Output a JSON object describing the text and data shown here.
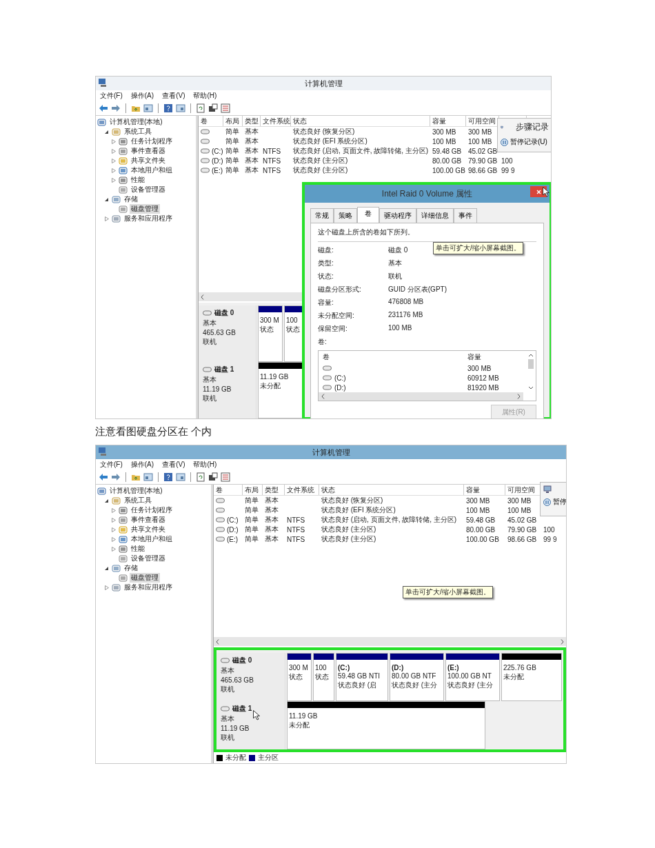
{
  "screenshots": [
    {
      "title": "计算机管理",
      "disks_highlighted": false,
      "menu": [
        "文件(F)",
        "操作(A)",
        "查看(V)",
        "帮助(H)"
      ],
      "tree": [
        {
          "label": "计算机管理(本地)",
          "selected": false,
          "children": [
            {
              "label": "系统工具",
              "selected": false,
              "expanded": true,
              "children": [
                {
                  "label": "任务计划程序",
                  "selected": false,
                  "expanded": false
                },
                {
                  "label": "事件查看器",
                  "selected": false,
                  "expanded": false
                },
                {
                  "label": "共享文件夹",
                  "selected": false,
                  "expanded": false
                },
                {
                  "label": "本地用户和组",
                  "selected": false,
                  "expanded": false
                },
                {
                  "label": "性能",
                  "selected": false,
                  "expanded": false
                },
                {
                  "label": "设备管理器",
                  "selected": false
                }
              ]
            },
            {
              "label": "存储",
              "selected": false,
              "expanded": true,
              "children": [
                {
                  "label": "磁盘管理",
                  "selected": true
                }
              ]
            },
            {
              "label": "服务和应用程序",
              "selected": false,
              "expanded": false
            }
          ]
        }
      ],
      "volume_table": {
        "columns": [
          "卷",
          "布局",
          "类型",
          "文件系统",
          "状态",
          "容量",
          "可用空间"
        ],
        "rows": [
          {
            "layout": "简单",
            "type": "基本",
            "status": "状态良好 (恢复分区)",
            "capacity": "300 MB",
            "free": "300 MB"
          },
          {
            "layout": "简单",
            "type": "基本",
            "status": "状态良好 (EFI 系统分区)",
            "capacity": "100 MB",
            "free": "100 MB"
          },
          {
            "volume": "(C:)",
            "layout": "简单",
            "type": "基本",
            "file_system": "NTFS",
            "status": "状态良好 (启动, 页面文件, 故障转储, 主分区)",
            "capacity": "59.48 GB",
            "free": "45.02 GB"
          },
          {
            "volume": "(D:)",
            "layout": "简单",
            "type": "基本",
            "file_system": "NTFS",
            "status": "状态良好 (主分区)",
            "capacity": "80.00 GB",
            "free": "79.90 GB",
            "column_8": "100"
          },
          {
            "volume": "(E:)",
            "layout": "简单",
            "type": "基本",
            "file_system": "NTFS",
            "status": "状态良好 (主分区)",
            "capacity": "100.00 GB",
            "free": "98.66 GB",
            "column_8": "99 9"
          }
        ]
      },
      "steps_recorder": {
        "title": "步骤记录",
        "button": "暂停记录(U)"
      },
      "disks": [
        {
          "name": "磁盘 0",
          "type": "基本",
          "size": "465.63 GB",
          "status": "联机",
          "partitions": [
            {
              "kind": "primary",
              "summary": "300 M",
              "status": "状态"
            },
            {
              "kind": "primary",
              "summary": "100",
              "status": "状态"
            }
          ]
        },
        {
          "name": "磁盘 1",
          "type": "基本",
          "size": "11.19 GB",
          "status": "联机",
          "partitions": [
            {
              "kind": "unallocated",
              "summary": "11.19 GB",
              "status": "未分配"
            }
          ]
        }
      ],
      "tooltip": "单击可扩大/缩小屏幕截图。",
      "dialog": {
        "title": "Intel Raid 0 Volume 属性",
        "highlighted": true,
        "tabs": [
          {
            "label": "常规",
            "selected": false
          },
          {
            "label": "策略",
            "selected": false
          },
          {
            "label": "卷",
            "selected": true
          },
          {
            "label": "驱动程序",
            "selected": false
          },
          {
            "label": "详细信息",
            "selected": false
          },
          {
            "label": "事件",
            "selected": false
          }
        ],
        "intro": "这个磁盘上所含的卷如下所列。",
        "properties": [
          {
            "label": "磁盘:",
            "value": "磁盘 0"
          },
          {
            "label": "类型:",
            "value": "基本"
          },
          {
            "label": "状态:",
            "value": "联机"
          },
          {
            "label": "磁盘分区形式:",
            "value": "GUID 分区表(GPT)"
          },
          {
            "label": "容量:",
            "value": "476808 MB"
          },
          {
            "label": "未分配空间:",
            "value": "231176 MB"
          },
          {
            "label": "保留空间:",
            "value": "100 MB"
          }
        ],
        "volumes_label": "卷:",
        "volumes": {
          "columns": [
            "卷",
            "容量"
          ],
          "rows": [
            {
              "capacity": "300 MB"
            },
            {
              "volume": "(C:)",
              "capacity": "60912 MB"
            },
            {
              "volume": "(D:)",
              "capacity": "81920 MB"
            }
          ]
        },
        "button": {
          "label": "属性(R)",
          "disabled": true
        }
      }
    },
    {
      "title": "计算机管理",
      "disks_highlighted": true,
      "menu": [
        "文件(F)",
        "操作(A)",
        "查看(V)",
        "帮助(H)"
      ],
      "tree": [
        {
          "label": "计算机管理(本地)",
          "selected": false,
          "children": [
            {
              "label": "系统工具",
              "selected": false,
              "expanded": true,
              "children": [
                {
                  "label": "任务计划程序",
                  "selected": false,
                  "expanded": false
                },
                {
                  "label": "事件查看器",
                  "selected": false,
                  "expanded": false
                },
                {
                  "label": "共享文件夹",
                  "selected": false,
                  "expanded": false
                },
                {
                  "label": "本地用户和组",
                  "selected": false,
                  "expanded": false
                },
                {
                  "label": "性能",
                  "selected": false,
                  "expanded": false
                },
                {
                  "label": "设备管理器",
                  "selected": false
                }
              ]
            },
            {
              "label": "存储",
              "selected": false,
              "expanded": true,
              "children": [
                {
                  "label": "磁盘管理",
                  "selected": true
                }
              ]
            },
            {
              "label": "服务和应用程序",
              "selected": false,
              "expanded": false
            }
          ]
        }
      ],
      "volume_table": {
        "columns": [
          "卷",
          "布局",
          "类型",
          "文件系统",
          "状态",
          "容量",
          "可用空间"
        ],
        "rows": [
          {
            "layout": "简单",
            "type": "基本",
            "status": "状态良好 (恢复分区)",
            "capacity": "300 MB",
            "free": "300 MB"
          },
          {
            "layout": "简单",
            "type": "基本",
            "status": "状态良好 (EFI 系统分区)",
            "capacity": "100 MB",
            "free": "100 MB"
          },
          {
            "volume": "(C:)",
            "layout": "简单",
            "type": "基本",
            "file_system": "NTFS",
            "status": "状态良好 (启动, 页面文件, 故障转储, 主分区)",
            "capacity": "59.48 GB",
            "free": "45.02 GB"
          },
          {
            "volume": "(D:)",
            "layout": "简单",
            "type": "基本",
            "file_system": "NTFS",
            "status": "状态良好 (主分区)",
            "capacity": "80.00 GB",
            "free": "79.90 GB",
            "column_8": "100"
          },
          {
            "volume": "(E:)",
            "layout": "简单",
            "type": "基本",
            "file_system": "NTFS",
            "status": "状态良好 (主分区)",
            "capacity": "100.00 GB",
            "free": "98.66 GB",
            "column_8": "99 9"
          }
        ]
      },
      "steps_recorder": {
        "button": "暂停"
      },
      "disks": [
        {
          "name": "磁盘 0",
          "type": "基本",
          "size": "465.63 GB",
          "status": "联机",
          "partitions": [
            {
              "kind": "primary",
              "summary": "300 M",
              "status": "状态"
            },
            {
              "kind": "primary",
              "summary": "100",
              "status": "状态"
            },
            {
              "kind": "primary",
              "drive": "(C:)",
              "summary": "59.48 GB NTI",
              "status": "状态良好 (启"
            },
            {
              "kind": "primary",
              "drive": "(D:)",
              "summary": "80.00 GB NTF",
              "status": "状态良好 (主分"
            },
            {
              "kind": "primary",
              "drive": "(E:)",
              "summary": "100.00 GB NT",
              "status": "状态良好 (主分"
            },
            {
              "kind": "unallocated",
              "summary": "225.76 GB",
              "status": "未分配"
            }
          ]
        },
        {
          "name": "磁盘 1",
          "type": "基本",
          "size": "11.19 GB",
          "status": "联机",
          "partitions": [
            {
              "kind": "unallocated",
              "summary": "11.19 GB",
              "status": "未分配"
            }
          ]
        }
      ],
      "legend": [
        {
          "label": "未分配",
          "color": "#000000"
        },
        {
          "label": "主分区",
          "color": "#000080"
        }
      ],
      "tooltip": "单击可扩大/缩小屏幕截图。"
    }
  ],
  "caption": "注意看图硬盘分区在 个内"
}
